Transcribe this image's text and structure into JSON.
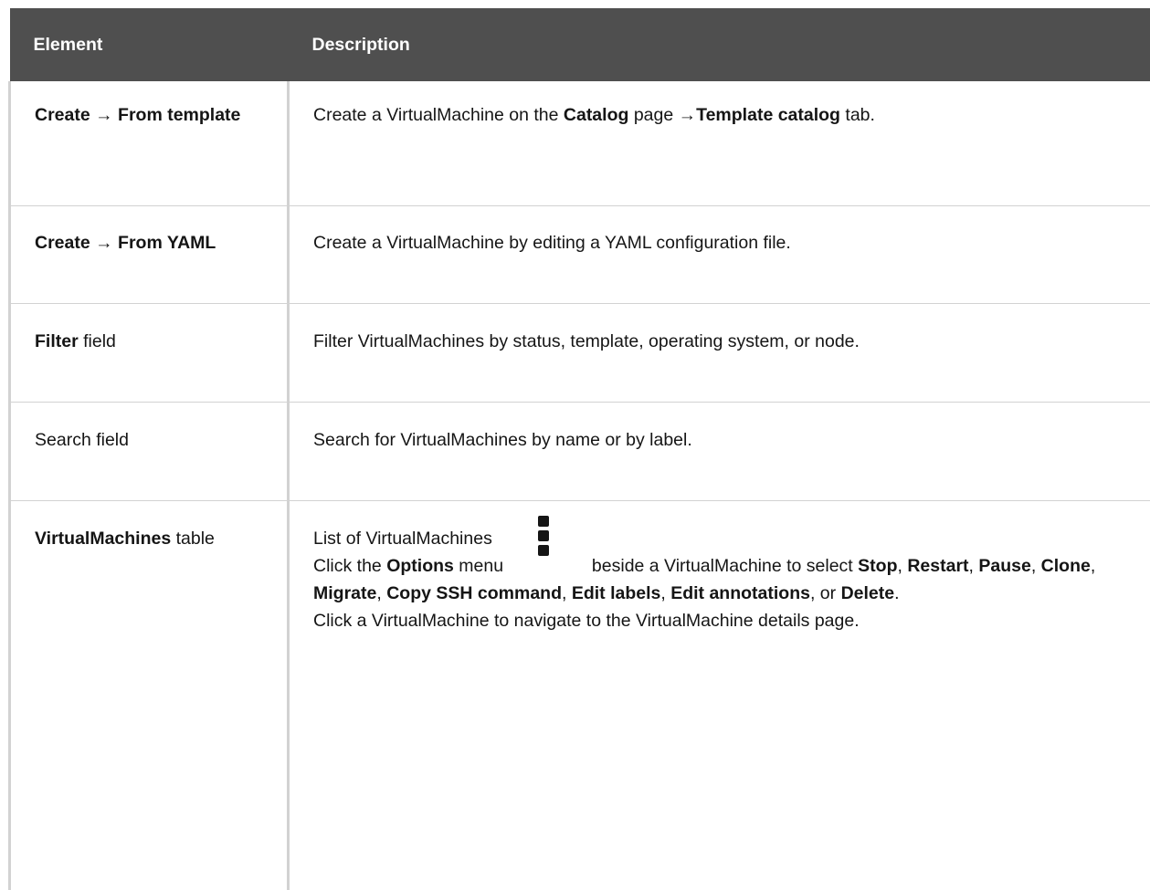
{
  "table": {
    "headers": {
      "element": "Element",
      "description": "Description"
    },
    "rows": [
      {
        "element_prefix": "",
        "element_bold": "Create → From template",
        "element_suffix": "",
        "description": {
          "t1": "Create a VirtualMachine on the ",
          "b1": "Catalog",
          "t2": " page →",
          "b2": "Template catalog",
          "t3": " tab."
        }
      },
      {
        "element_bold": "Create → From YAML",
        "description": {
          "t1": "Create a VirtualMachine by editing a YAML configuration file."
        }
      },
      {
        "element_bold": "Filter",
        "element_suffix": " field",
        "description": {
          "t1": "Filter VirtualMachines by status, template, operating system, or node."
        }
      },
      {
        "element_plain": "Search field",
        "description": {
          "t1": "Search for VirtualMachines by name or by label."
        }
      },
      {
        "element_bold": "VirtualMachines",
        "element_suffix": " table",
        "description": {
          "p1": "List of VirtualMachines",
          "p2_t1": "Click the ",
          "p2_b1": "Options",
          "p2_t2": " menu ",
          "p2_icon": "kebab-menu-icon",
          "p2_t3": " beside a VirtualMachine to select ",
          "p2_b2": "Stop",
          "p2_t4": ", ",
          "p2_b3": "Restart",
          "p2_t5": ", ",
          "p2_b4": "Pause",
          "p2_t6": ", ",
          "p2_b5": "Clone",
          "p2_t7": ", ",
          "p2_b6": "Migrate",
          "p2_t8": ", ",
          "p2_b7": "Copy SSH command",
          "p2_t9": ", ",
          "p2_b8": "Edit labels",
          "p2_t10": ", ",
          "p2_b9": "Edit annotations",
          "p2_t11": ", or ",
          "p2_b10": "Delete",
          "p2_t12": ".",
          "p3": "Click a VirtualMachine to navigate to the VirtualMachine details page."
        }
      }
    ]
  },
  "colors": {
    "header_bg": "#4f4f4f",
    "header_text": "#ffffff",
    "border": "#d2d2d2",
    "text": "#151515"
  }
}
